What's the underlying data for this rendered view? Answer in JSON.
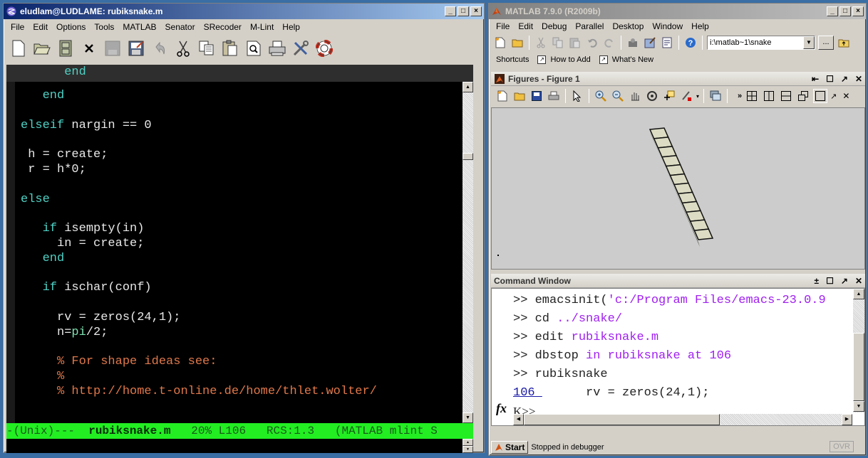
{
  "emacs": {
    "title": "eludlam@LUDLAME: rubiksnake.m",
    "menu": [
      "File",
      "Edit",
      "Options",
      "Tools",
      "MATLAB",
      "Senator",
      "SRecoder",
      "M-Lint",
      "Help"
    ],
    "toolbar_icons": [
      "new-file-icon",
      "open-folder-icon",
      "dired-cabinet-icon",
      "close-buffer-icon",
      "save-disabled-icon",
      "save-as-icon",
      "undo-icon",
      "cut-icon",
      "copy-icon",
      "paste-icon",
      "search-icon",
      "print-icon",
      "customize-icon",
      "help-lifebuoy-icon"
    ],
    "header_line": "      end",
    "code_lines": [
      {
        "indent": "   ",
        "parts": [
          {
            "t": "end",
            "c": "kw"
          }
        ]
      },
      {
        "indent": "",
        "parts": []
      },
      {
        "indent": "",
        "parts": [
          {
            "t": "elseif",
            "c": "kw"
          },
          {
            "t": " nargin == 0",
            "c": ""
          }
        ]
      },
      {
        "indent": "",
        "parts": []
      },
      {
        "indent": " ",
        "parts": [
          {
            "t": "h = create;",
            "c": ""
          }
        ]
      },
      {
        "indent": " ",
        "parts": [
          {
            "t": "r = h*0;",
            "c": ""
          }
        ]
      },
      {
        "indent": "",
        "parts": []
      },
      {
        "indent": "",
        "parts": [
          {
            "t": "else",
            "c": "kw"
          }
        ]
      },
      {
        "indent": "",
        "parts": []
      },
      {
        "indent": "   ",
        "parts": [
          {
            "t": "if",
            "c": "kw"
          },
          {
            "t": " isempty(in)",
            "c": ""
          }
        ]
      },
      {
        "indent": "     ",
        "parts": [
          {
            "t": "in = create;",
            "c": ""
          }
        ]
      },
      {
        "indent": "   ",
        "parts": [
          {
            "t": "end",
            "c": "kw"
          }
        ]
      },
      {
        "indent": "",
        "parts": []
      },
      {
        "indent": "   ",
        "parts": [
          {
            "t": "if",
            "c": "kw"
          },
          {
            "t": " ischar(conf)",
            "c": ""
          }
        ]
      },
      {
        "indent": "",
        "parts": []
      },
      {
        "indent": "     ",
        "parts": [
          {
            "t": "rv = zeros(24,1);",
            "c": ""
          }
        ]
      },
      {
        "indent": "     ",
        "parts": [
          {
            "t": "n=",
            "c": ""
          },
          {
            "t": "pi",
            "c": "bi"
          },
          {
            "t": "/2;",
            "c": ""
          }
        ]
      },
      {
        "indent": "",
        "parts": []
      },
      {
        "indent": "     ",
        "parts": [
          {
            "t": "% For shape ideas see:",
            "c": "cm"
          }
        ]
      },
      {
        "indent": "     ",
        "parts": [
          {
            "t": "%",
            "c": "cm"
          }
        ]
      },
      {
        "indent": "     ",
        "parts": [
          {
            "t": "% http://home.t-online.de/home/thlet.wolter/",
            "c": "cm"
          }
        ]
      }
    ],
    "modeline": {
      "prefix": "-(Unix)---  ",
      "buffer": "rubiksnake.m",
      "position": "   20% L106   RCS:1.3   (MATLAB mlint S"
    }
  },
  "matlab": {
    "title": "MATLAB  7.9.0 (R2009b)",
    "menu": [
      "File",
      "Edit",
      "Debug",
      "Parallel",
      "Desktop",
      "Window",
      "Help"
    ],
    "current_folder": "i:\\matlab~1\\snake",
    "browse_label": "...",
    "shortcuts_label": "Shortcuts",
    "shortcut_links": [
      "How to Add",
      "What's New"
    ],
    "figures_title": "Figures - Figure 1",
    "figure_toolbar_icons": [
      "new-figure-icon",
      "open-icon",
      "save-icon",
      "print-icon",
      "select-arrow-icon",
      "zoom-in-icon",
      "zoom-out-icon",
      "pan-hand-icon",
      "rotate-3d-icon",
      "data-cursor-icon",
      "brush-icon",
      "link-plot-icon"
    ],
    "figure_segments": 12,
    "command_window_title": "Command Window",
    "command_lines": [
      {
        "prompt": ">> ",
        "parts": [
          {
            "t": "emacsinit(",
            "c": ""
          },
          {
            "t": "'c:/Program Files/emacs-23.0.9",
            "c": "str"
          }
        ]
      },
      {
        "prompt": ">> ",
        "parts": [
          {
            "t": "cd ",
            "c": ""
          },
          {
            "t": "../snake/",
            "c": "str"
          }
        ]
      },
      {
        "prompt": ">> ",
        "parts": [
          {
            "t": "edit ",
            "c": ""
          },
          {
            "t": "rubiksnake.m",
            "c": "str"
          }
        ]
      },
      {
        "prompt": ">> ",
        "parts": [
          {
            "t": "dbstop ",
            "c": ""
          },
          {
            "t": "in rubiksnake at 106",
            "c": "str"
          }
        ]
      },
      {
        "prompt": ">> ",
        "parts": [
          {
            "t": "rubiksnake",
            "c": ""
          }
        ]
      }
    ],
    "debug_line_number": "106 ",
    "debug_line_code": "      rv = zeros(24,1);",
    "debug_prompt": "K>>",
    "fx_label": "fx",
    "start_label": "Start",
    "status_text": "Stopped in debugger",
    "ovr_label": "OVR"
  }
}
